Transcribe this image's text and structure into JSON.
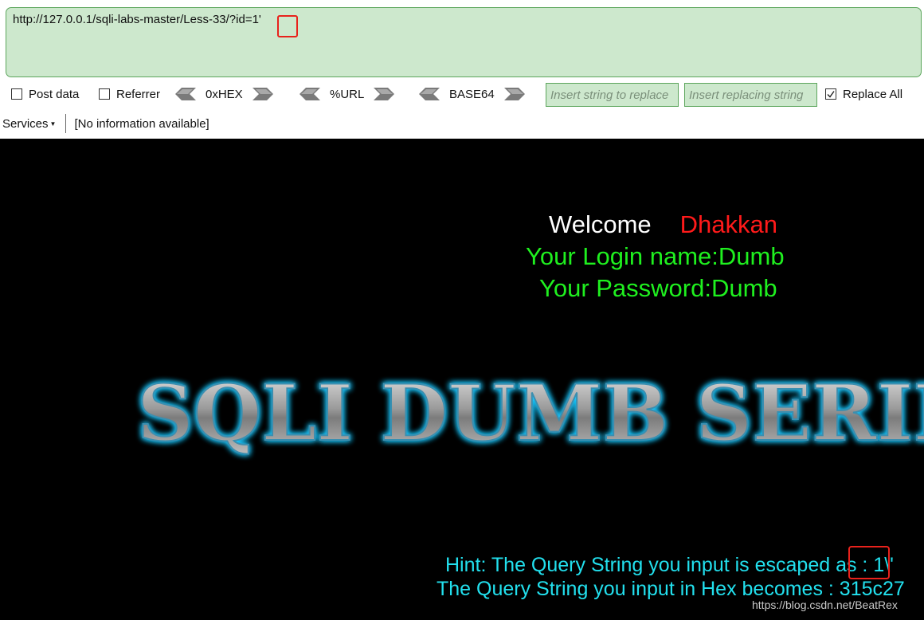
{
  "toolbar": {
    "url": "http://127.0.0.1/sqli-labs-master/Less-33/?id=1'",
    "post_data_label": "Post data",
    "post_data_checked": false,
    "referrer_label": "Referrer",
    "referrer_checked": false,
    "hex_label": "0xHEX",
    "url_label": "%URL",
    "base64_label": "BASE64",
    "replace_placeholder": "Insert string to replace",
    "replacing_placeholder": "Insert replacing string",
    "replace_all_label": "Replace All",
    "replace_all_checked": true
  },
  "services": {
    "label": "Services",
    "info": "[No information available]"
  },
  "page": {
    "welcome": "Welcome",
    "user": "Dhakkan",
    "login_line": "Your Login name:Dumb",
    "password_line": "Your Password:Dumb",
    "banner_text": "SQLI DUMB SERIES",
    "hint_line": "Hint: The Query String you input is escaped as : 1\\'",
    "hex_line": "The Query String you input in Hex becomes : 315c27",
    "watermark": "https://blog.csdn.net/BeatRex"
  },
  "colors": {
    "accent_highlight": "#e8221c",
    "url_bar_bg": "#cde8cd",
    "welcome_user": "#ff1a1a",
    "login_text": "#1ff01f",
    "hint_text": "#22e0ee"
  }
}
